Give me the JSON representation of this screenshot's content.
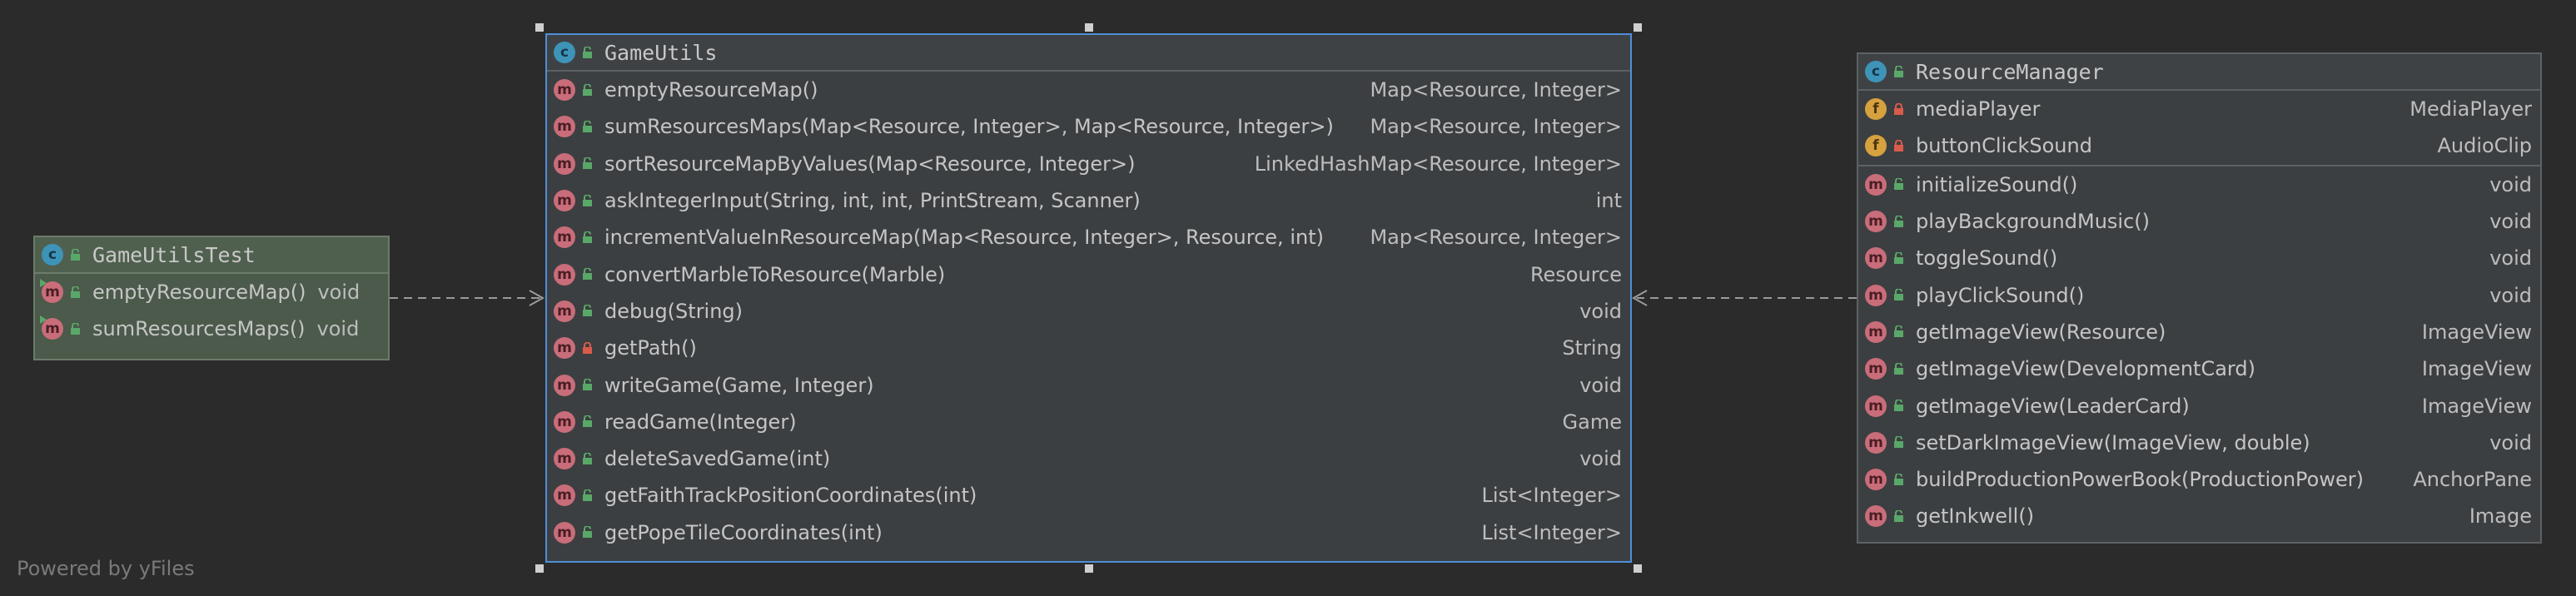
{
  "footer": "Powered by yFiles",
  "colors": {
    "background": "#2b2b2b",
    "class_badge": "#3d94b8",
    "method_badge": "#c96d7a",
    "field_badge": "#d6a13f",
    "public_lock": "#59a869",
    "private_lock": "#d95b4b",
    "selection": "#4f8fd9",
    "edge": "#9a9a9a"
  },
  "nodes": {
    "game_utils_test": {
      "title": "GameUtilsTest",
      "icon": "class-icon",
      "methods": [
        {
          "sig": "emptyResourceMap()",
          "type": "void"
        },
        {
          "sig": "sumResourcesMaps()",
          "type": "void"
        }
      ]
    },
    "game_utils": {
      "title": "GameUtils",
      "icon": "class-icon",
      "methods": [
        {
          "sig": "emptyResourceMap()",
          "type": "Map<Resource, Integer>",
          "visibility": "public"
        },
        {
          "sig": "sumResourcesMaps(Map<Resource, Integer>, Map<Resource, Integer>)",
          "type": "Map<Resource, Integer>",
          "visibility": "public"
        },
        {
          "sig": "sortResourceMapByValues(Map<Resource, Integer>)",
          "type": "LinkedHashMap<Resource, Integer>",
          "visibility": "public"
        },
        {
          "sig": "askIntegerInput(String, int, int, PrintStream, Scanner)",
          "type": "int",
          "visibility": "public"
        },
        {
          "sig": "incrementValueInResourceMap(Map<Resource, Integer>, Resource, int)",
          "type": "Map<Resource, Integer>",
          "visibility": "public"
        },
        {
          "sig": "convertMarbleToResource(Marble)",
          "type": "Resource",
          "visibility": "public"
        },
        {
          "sig": "debug(String)",
          "type": "void",
          "visibility": "public"
        },
        {
          "sig": "getPath()",
          "type": "String",
          "visibility": "private"
        },
        {
          "sig": "writeGame(Game, Integer)",
          "type": "void",
          "visibility": "public"
        },
        {
          "sig": "readGame(Integer)",
          "type": "Game",
          "visibility": "public"
        },
        {
          "sig": "deleteSavedGame(int)",
          "type": "void",
          "visibility": "public"
        },
        {
          "sig": "getFaithTrackPositionCoordinates(int)",
          "type": "List<Integer>",
          "visibility": "public"
        },
        {
          "sig": "getPopeTileCoordinates(int)",
          "type": "List<Integer>",
          "visibility": "public"
        }
      ]
    },
    "resource_manager": {
      "title": "ResourceManager",
      "icon": "class-icon",
      "fields": [
        {
          "sig": "mediaPlayer",
          "type": "MediaPlayer",
          "visibility": "private"
        },
        {
          "sig": "buttonClickSound",
          "type": "AudioClip",
          "visibility": "private"
        }
      ],
      "methods": [
        {
          "sig": "initializeSound()",
          "type": "void",
          "visibility": "public"
        },
        {
          "sig": "playBackgroundMusic()",
          "type": "void",
          "visibility": "public"
        },
        {
          "sig": "toggleSound()",
          "type": "void",
          "visibility": "public"
        },
        {
          "sig": "playClickSound()",
          "type": "void",
          "visibility": "public"
        },
        {
          "sig": "getImageView(Resource)",
          "type": "ImageView",
          "visibility": "public"
        },
        {
          "sig": "getImageView(DevelopmentCard)",
          "type": "ImageView",
          "visibility": "public"
        },
        {
          "sig": "getImageView(LeaderCard)",
          "type": "ImageView",
          "visibility": "public"
        },
        {
          "sig": "setDarkImageView(ImageView, double)",
          "type": "void",
          "visibility": "public"
        },
        {
          "sig": "buildProductionPowerBook(ProductionPower)",
          "type": "AnchorPane",
          "visibility": "public"
        },
        {
          "sig": "getInkwell()",
          "type": "Image",
          "visibility": "public"
        }
      ]
    }
  },
  "edges": [
    {
      "from": "GameUtilsTest",
      "to": "GameUtils",
      "style": "dashed"
    },
    {
      "from": "ResourceManager",
      "to": "GameUtils",
      "style": "dashed"
    }
  ]
}
